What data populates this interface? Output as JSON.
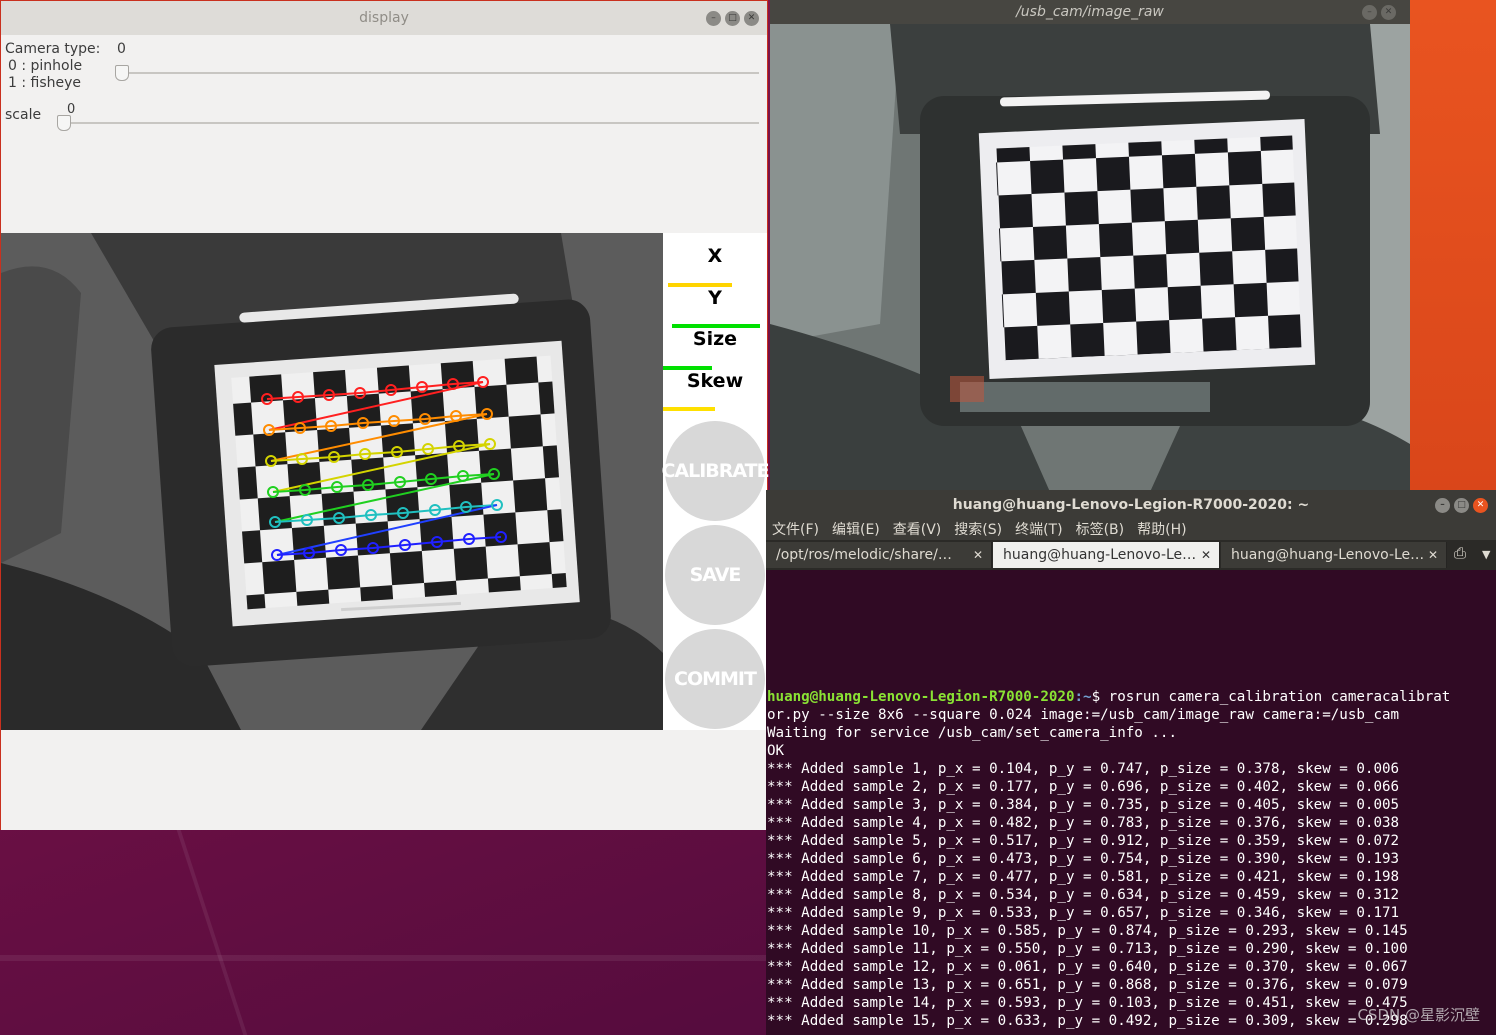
{
  "display_window": {
    "title": "display",
    "camera_type_label": "Camera type:",
    "camera_type_option0": "0 : pinhole",
    "camera_type_option1": "1 : fisheye",
    "camera_type_value": "0",
    "scale_label": "scale",
    "scale_value": "0",
    "metrics": [
      {
        "label": "X",
        "bar_color": "#ffd400",
        "fill": 0.62
      },
      {
        "label": "Y",
        "bar_color": "#00e000",
        "fill": 0.85
      },
      {
        "label": "Size",
        "bar_color": "#00e000",
        "fill": 0.47
      },
      {
        "label": "Skew",
        "bar_color": "#ffe000",
        "fill": 0.5
      }
    ],
    "buttons": {
      "calibrate": "CALIBRATE",
      "save": "SAVE",
      "commit": "COMMIT"
    }
  },
  "usbcam_window": {
    "title": "/usb_cam/image_raw"
  },
  "terminal": {
    "title": "huang@huang-Lenovo-Legion-R7000-2020: ~",
    "menu": [
      "文件(F)",
      "编辑(E)",
      "查看(V)",
      "搜索(S)",
      "终端(T)",
      "标签(B)",
      "帮助(H)"
    ],
    "tabs": [
      "/opt/ros/melodic/share/…",
      "huang@huang-Lenovo-Le…",
      "huang@huang-Lenovo-Le…"
    ],
    "prompt_user": "huang@huang-Lenovo-Legion-R7000-2020",
    "prompt_path": ":~",
    "prompt_cmd": "$ rosrun camera_calibration cameracalibrat",
    "lines": [
      "or.py --size 8x6 --square 0.024 image:=/usb_cam/image_raw camera:=/usb_cam",
      "Waiting for service /usb_cam/set_camera_info ...",
      "OK",
      "*** Added sample 1, p_x = 0.104, p_y = 0.747, p_size = 0.378, skew = 0.006",
      "*** Added sample 2, p_x = 0.177, p_y = 0.696, p_size = 0.402, skew = 0.066",
      "*** Added sample 3, p_x = 0.384, p_y = 0.735, p_size = 0.405, skew = 0.005",
      "*** Added sample 4, p_x = 0.482, p_y = 0.783, p_size = 0.376, skew = 0.038",
      "*** Added sample 5, p_x = 0.517, p_y = 0.912, p_size = 0.359, skew = 0.072",
      "*** Added sample 6, p_x = 0.473, p_y = 0.754, p_size = 0.390, skew = 0.193",
      "*** Added sample 7, p_x = 0.477, p_y = 0.581, p_size = 0.421, skew = 0.198",
      "*** Added sample 8, p_x = 0.534, p_y = 0.634, p_size = 0.459, skew = 0.312",
      "*** Added sample 9, p_x = 0.533, p_y = 0.657, p_size = 0.346, skew = 0.171",
      "*** Added sample 10, p_x = 0.585, p_y = 0.874, p_size = 0.293, skew = 0.145",
      "*** Added sample 11, p_x = 0.550, p_y = 0.713, p_size = 0.290, skew = 0.100",
      "*** Added sample 12, p_x = 0.061, p_y = 0.640, p_size = 0.370, skew = 0.067",
      "*** Added sample 13, p_x = 0.651, p_y = 0.868, p_size = 0.376, skew = 0.079",
      "*** Added sample 14, p_x = 0.593, p_y = 0.103, p_size = 0.451, skew = 0.475",
      "*** Added sample 15, p_x = 0.633, p_y = 0.492, p_size = 0.309, skew = 0.298"
    ],
    "watermark": "CSDN @星影沉壁"
  }
}
